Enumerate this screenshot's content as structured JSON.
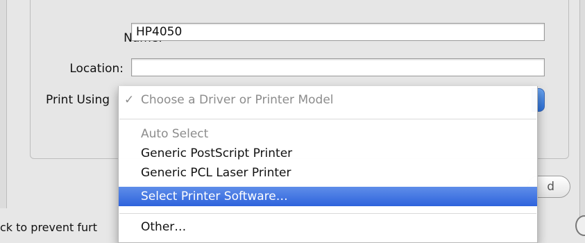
{
  "form": {
    "name_label": "Name:",
    "name_value": "HP4050",
    "location_label": "Location:",
    "location_value": "",
    "print_using_label": "Print Using"
  },
  "popup_menu": {
    "items": [
      {
        "label": "Choose a Driver or Printer Model",
        "checked": true,
        "enabled": false
      },
      {
        "label": "Auto Select",
        "enabled": false
      },
      {
        "label": "Generic PostScript Printer",
        "enabled": true
      },
      {
        "label": "Generic PCL Laser Printer",
        "enabled": true
      },
      {
        "label": "Select Printer Software…",
        "enabled": true,
        "highlighted": true
      },
      {
        "label": "Other…",
        "enabled": true
      }
    ],
    "check_glyph": "✓"
  },
  "background": {
    "bottom_text": "ck to prevent furt",
    "partial_button_label": "d"
  },
  "colors": {
    "highlight": "#3d6fe0",
    "disabled_text": "#8c8c8c"
  }
}
